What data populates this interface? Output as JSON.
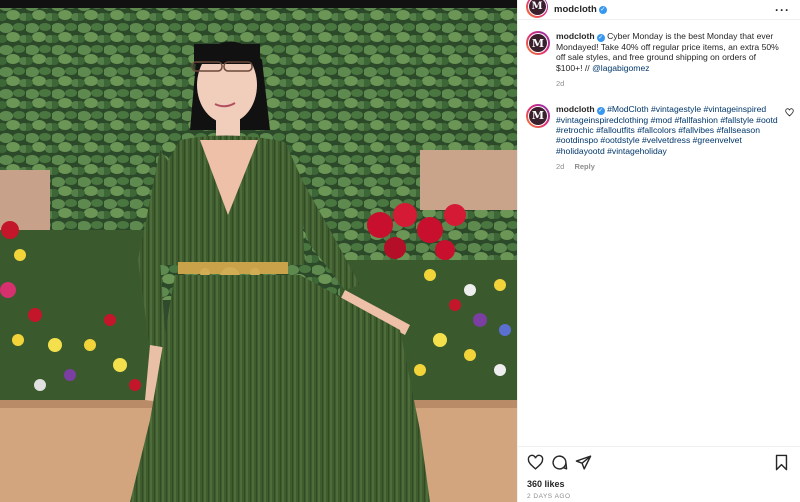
{
  "post": {
    "author": "modcloth",
    "avatar_letter": "M",
    "more_label": "···",
    "image_alt": "Woman in green velvet dress standing in front of ivy wall and flower bed"
  },
  "comments": [
    {
      "author": "modcloth",
      "text": "Cyber Monday is the best Monday that ever Mondayed! Take 40% off regular price items, an extra 50% off sale styles, and free ground shipping on orders of $100+! // ",
      "mention": "@lagabigomez",
      "time": "2d"
    },
    {
      "author": "modcloth",
      "hashtags": "#ModCloth #vintagestyle #vintageinspired #vintageinspiredclothing #mod #fallfashion #fallstyle #ootd #retrochic #falloutfits #fallcolors #fallvibes #fallseason #ootdinspo #ootdstyle #velvetdress #greenvelvet #holidayootd #vintageholiday",
      "time": "2d",
      "reply_label": "Reply"
    }
  ],
  "footer": {
    "likes": "360 likes",
    "date": "2 DAYS AGO"
  },
  "icons": {
    "like": "heart-icon",
    "comment": "comment-icon",
    "share": "share-icon",
    "save": "bookmark-icon",
    "verified": "verified-badge-icon"
  },
  "colors": {
    "verified": "#3897f0",
    "hashtag": "#00376b",
    "muted": "#8e8e8e",
    "dress": "#3d5a2e"
  }
}
